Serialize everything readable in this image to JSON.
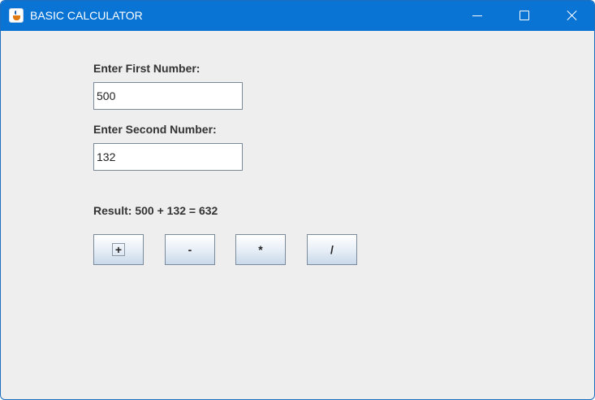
{
  "window": {
    "title": "BASIC CALCULATOR",
    "app_icon": "java-cup-icon"
  },
  "titlebar_controls": {
    "minimize_icon": "minimize-icon",
    "maximize_icon": "maximize-icon",
    "close_icon": "close-icon"
  },
  "form": {
    "first_label": "Enter First Number:",
    "first_value": "500",
    "second_label": "Enter Second Number:",
    "second_value": "132",
    "result_text": "Result:  500 + 132 = 632"
  },
  "buttons": {
    "add": "+",
    "subtract": "-",
    "multiply": "*",
    "divide": "/"
  },
  "colors": {
    "titlebar": "#0a74d4",
    "window_bg": "#eeeeee"
  }
}
